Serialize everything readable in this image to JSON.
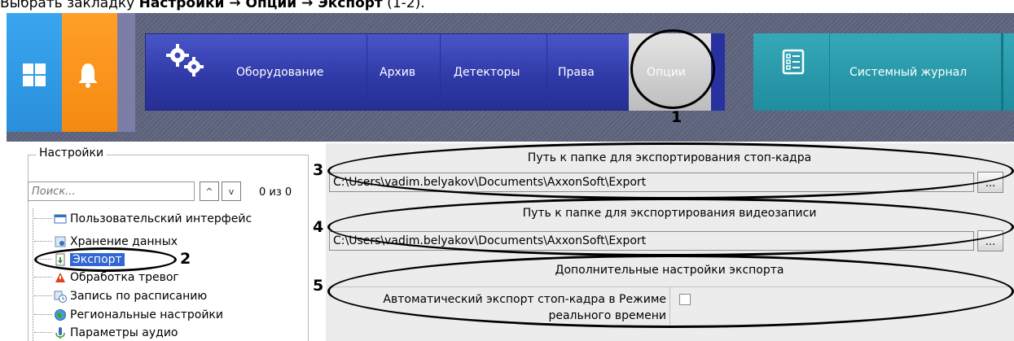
{
  "caption": {
    "prefix": "Выбрать закладку ",
    "bold_text": "Настройки → Опции → Экспорт",
    "suffix": " (1-2)."
  },
  "nav": {
    "equipment": "Оборудование",
    "archive": "Архив",
    "detectors": "Детекторы",
    "rights": "Права",
    "options": "Опции",
    "system_log": "Системный журнал"
  },
  "callouts": {
    "n1": "1",
    "n2": "2",
    "n3": "3",
    "n4": "4",
    "n5": "5"
  },
  "settings": {
    "title": "Настройки",
    "search_placeholder": "Поиск...",
    "up_arrow": "^",
    "down_arrow": "v",
    "counter": "0 из 0",
    "tree": [
      {
        "label": "Пользовательский интерфейс",
        "icon": "ui-icon"
      },
      {
        "label": "Хранение данных",
        "icon": "storage-icon"
      },
      {
        "label": "Экспорт",
        "icon": "export-icon",
        "selected": true
      },
      {
        "label": "Обработка тревог",
        "icon": "alarm-icon"
      },
      {
        "label": "Запись по расписанию",
        "icon": "schedule-icon"
      },
      {
        "label": "Региональные настройки",
        "icon": "globe-icon"
      },
      {
        "label": "Параметры аудио",
        "icon": "audio-icon"
      }
    ]
  },
  "export": {
    "snapshot_header": "Путь к папке для экспортирования стоп-кадра",
    "snapshot_path": "C:\\Users\\vadim.belyakov\\Documents\\AxxonSoft\\Export",
    "video_header": "Путь к папке для экспортирования видеозаписи",
    "video_path": "C:\\Users\\vadim.belyakov\\Documents\\AxxonSoft\\Export",
    "browse_label": "...",
    "additional_header": "Дополнительные настройки экспорта",
    "auto_export_label": "Автоматический экспорт стоп-кадра в Режиме реального времени",
    "auto_export_checked": false
  }
}
